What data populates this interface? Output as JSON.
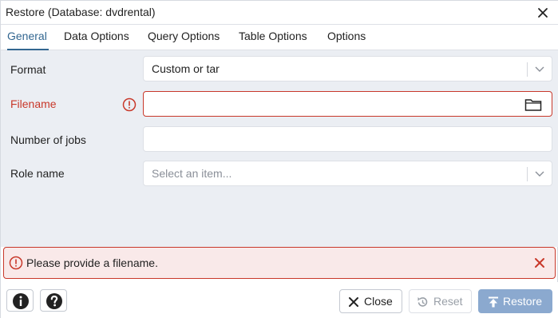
{
  "dialog": {
    "title": "Restore (Database: dvdrental)"
  },
  "tabs": [
    {
      "label": "General"
    },
    {
      "label": "Data Options"
    },
    {
      "label": "Query Options"
    },
    {
      "label": "Table Options"
    },
    {
      "label": "Options"
    }
  ],
  "form": {
    "format": {
      "label": "Format",
      "value": "Custom or tar"
    },
    "filename": {
      "label": "Filename",
      "value": ""
    },
    "jobs": {
      "label": "Number of jobs",
      "value": ""
    },
    "role": {
      "label": "Role name",
      "placeholder": "Select an item..."
    }
  },
  "alert": {
    "message": "Please provide a filename."
  },
  "footer": {
    "close_label": "Close",
    "reset_label": "Reset",
    "restore_label": "Restore"
  },
  "colors": {
    "accent": "#326690",
    "error": "#c8382a",
    "restore_button": "#8ba9cf",
    "content_bg": "#ebeef3"
  },
  "icons": {
    "close_dialog": "close-icon",
    "filename_error": "error-circle-icon",
    "browse": "folder-icon",
    "info": "info-icon",
    "help": "help-icon",
    "reset": "undo-icon",
    "restore": "upload-icon"
  }
}
